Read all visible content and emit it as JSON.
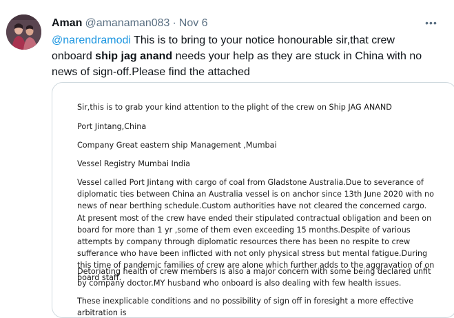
{
  "author": {
    "name": "Aman",
    "handle": "@amanaman083",
    "separator": "·",
    "date": "Nov 6",
    "avatar_icon": "profile-photo"
  },
  "more_icon": "more-horizontal-icon",
  "more_glyph": "•••",
  "tweet": {
    "mention": "@narendramodi",
    "text_1": " This is to bring to your notice honourable sir,that crew onboard ",
    "bold": "ship jag anand",
    "text_2": " needs your help as they are stuck in China with no news of sign-off.Please find the attached"
  },
  "attachment": {
    "paragraphs": [
      "Sir,this is to grab your kind attention to the plight of the crew on Ship JAG ANAND",
      "Port Jintang,China",
      "Company Great eastern ship Management ,Mumbai",
      "Vessel Registry Mumbai India",
      "Vessel called Port Jintang with cargo of coal from Gladstone Australia.Due to severance of diplomatic ties between China an Australia vessel is on anchor since 13th June 2020 with no news of near berthing schedule.Custom authorities have not cleared the concerned cargo. At present most of the crew have ended their stipulated contractual obligation and been on board for more than 1 yr ,some of them even exceeding 15 months.Despite of various attempts by company through diplomatic resources there has been no respite to crew sufferance who have been inflicted with not only physical stress but mental fatigue.During this time of pandemic families of crew are alone which further adds to the aggravation of on board staff.",
      "Detoriating health of crew members is also a major concern with some being declared unfit by company doctor.MY husband who onboard  is also dealing with few health issues.",
      "These inexplicable conditions and no possibility of sign off in foresight a more effective arbitration  is"
    ]
  },
  "colors": {
    "link": "#1b95e0",
    "secondary": "#5b7083",
    "border": "#cfd9de"
  }
}
